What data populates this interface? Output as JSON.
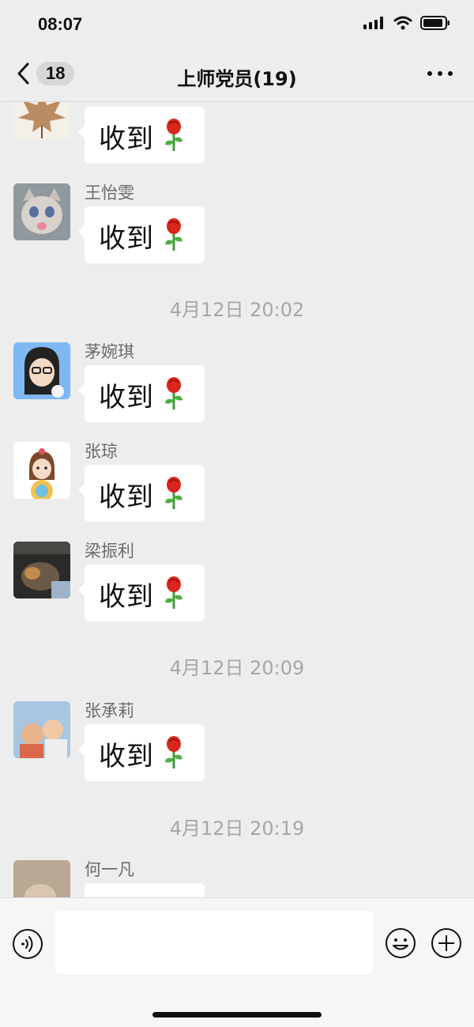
{
  "status_bar": {
    "time": "08:07"
  },
  "header": {
    "back_count": "18",
    "title": "上师党员(19)"
  },
  "messages": [
    {
      "name": "",
      "text": "收到",
      "avatar": "maple-leaf-avatar"
    },
    {
      "name": "王怡雯",
      "text": "收到",
      "avatar": "cat-avatar"
    },
    {
      "timestamp": "4月12日 20:02"
    },
    {
      "name": "茅婉琪",
      "text": "收到",
      "avatar": "cartoon-girl-glasses-avatar"
    },
    {
      "name": "张琼",
      "text": "收到",
      "avatar": "cartoon-girl-lollipop-avatar"
    },
    {
      "name": "梁振利",
      "text": "收到",
      "avatar": "cat-chanel-avatar"
    },
    {
      "timestamp": "4月12日 20:09"
    },
    {
      "name": "张承莉",
      "text": "收到",
      "avatar": "children-photo-avatar"
    },
    {
      "timestamp": "4月12日 20:19"
    },
    {
      "name": "何一凡",
      "text": "",
      "avatar": "blurred-photo-avatar"
    }
  ],
  "icons": [
    "back-chevron-icon",
    "more-icon",
    "rose-emoji-icon",
    "voice-icon",
    "emoji-icon",
    "plus-icon",
    "signal-icon",
    "wifi-icon",
    "battery-icon"
  ]
}
